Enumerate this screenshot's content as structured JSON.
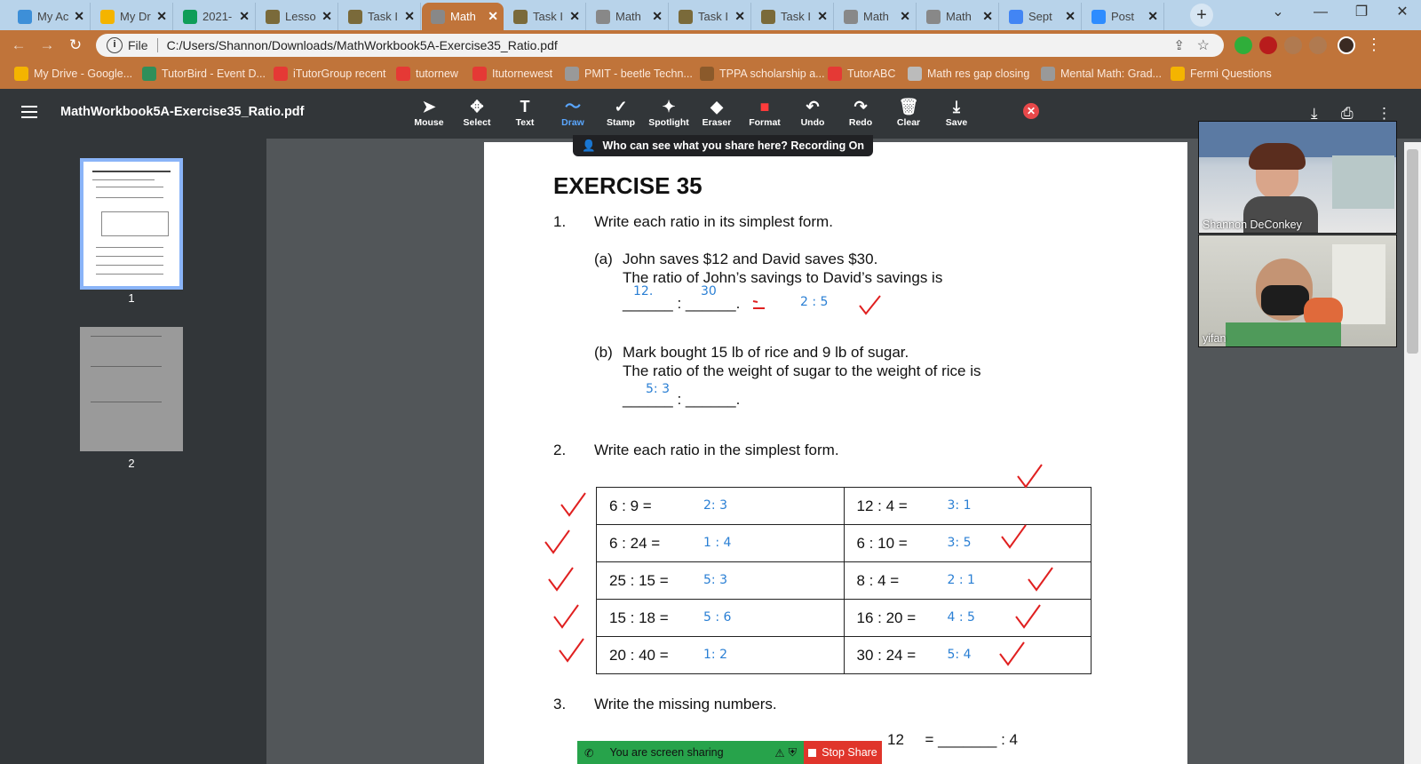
{
  "tabs": [
    {
      "label": "My Ac",
      "color": "#3d8fd8"
    },
    {
      "label": "My Dr",
      "color": "#f4b400"
    },
    {
      "label": "2021-",
      "color": "#0f9d58"
    },
    {
      "label": "Lesso",
      "color": "#7a6a3a"
    },
    {
      "label": "Task I",
      "color": "#7a6a3a"
    },
    {
      "label": "Math",
      "color": "#888888"
    },
    {
      "label": "Task I",
      "color": "#7a6a3a"
    },
    {
      "label": "Math",
      "color": "#888888"
    },
    {
      "label": "Task I",
      "color": "#7a6a3a"
    },
    {
      "label": "Task I",
      "color": "#7a6a3a"
    },
    {
      "label": "Math",
      "color": "#888888"
    },
    {
      "label": "Math",
      "color": "#888888"
    },
    {
      "label": "Sept",
      "color": "#4285f4"
    },
    {
      "label": "Post",
      "color": "#2d8cff"
    }
  ],
  "address": {
    "scheme_label": "File",
    "url": "C:/Users/Shannon/Downloads/MathWorkbook5A-Exercise35_Ratio.pdf"
  },
  "bookmarks": [
    {
      "label": "My Drive - Google...",
      "color": "#f4b400"
    },
    {
      "label": "TutorBird - Event D...",
      "color": "#2f8f5a"
    },
    {
      "label": "iTutorGroup recent",
      "color": "#e53935"
    },
    {
      "label": "tutornew",
      "color": "#e53935"
    },
    {
      "label": "Itutornewest",
      "color": "#e53935"
    },
    {
      "label": "PMIT - beetle Techn...",
      "color": "#999999"
    },
    {
      "label": "TPPA scholarship a...",
      "color": "#8b5a2b"
    },
    {
      "label": "TutorABC",
      "color": "#e53935"
    },
    {
      "label": "Math res gap closing",
      "color": "#bbbbbb"
    },
    {
      "label": "Mental Math: Grad...",
      "color": "#999999"
    },
    {
      "label": "Fermi Questions",
      "color": "#f4b400"
    }
  ],
  "viewer": {
    "filename": "MathWorkbook5A-Exercise35_Ratio.pdf"
  },
  "tools": [
    {
      "label": "Mouse",
      "icon": "cursor-icon",
      "glyph": "➤"
    },
    {
      "label": "Select",
      "icon": "move-icon",
      "glyph": "✥"
    },
    {
      "label": "Text",
      "icon": "text-icon",
      "glyph": "T"
    },
    {
      "label": "Draw",
      "icon": "draw-icon",
      "glyph": "〜"
    },
    {
      "label": "Stamp",
      "icon": "stamp-icon",
      "glyph": "✓"
    },
    {
      "label": "Spotlight",
      "icon": "spotlight-icon",
      "glyph": "✦"
    },
    {
      "label": "Eraser",
      "icon": "eraser-icon",
      "glyph": "◆"
    },
    {
      "label": "Format",
      "icon": "format-icon",
      "glyph": "■"
    },
    {
      "label": "Undo",
      "icon": "undo-icon",
      "glyph": "↶"
    },
    {
      "label": "Redo",
      "icon": "redo-icon",
      "glyph": "↷"
    },
    {
      "label": "Clear",
      "icon": "trash-icon",
      "glyph": "🗑"
    },
    {
      "label": "Save",
      "icon": "save-icon",
      "glyph": "⤓"
    }
  ],
  "share_notice": "Who can see what you share here? Recording On",
  "thumbnails": [
    "1",
    "2"
  ],
  "doc": {
    "title": "EXERCISE 35",
    "q1_num": "1.",
    "q1_text": "Write each ratio in its simplest form.",
    "q1a_label": "(a)",
    "q1a_line1": "John saves $12 and David saves $30.",
    "q1a_line2": "The ratio of John’s savings to David’s savings is",
    "q1a_blank": "______ : ______.",
    "q1a_hw1": "12.",
    "q1a_hw2": "30",
    "q1a_hw3": "2 : 5",
    "q1b_label": "(b)",
    "q1b_line1": "Mark bought 15 lb of rice and 9 lb of sugar.",
    "q1b_line2": "The ratio of the weight of sugar to the weight of rice is",
    "q1b_blank": "______ : ______.",
    "q1b_hw": "5: 3",
    "q2_num": "2.",
    "q2_text": "Write each ratio in the simplest form.",
    "q3_num": "3.",
    "q3_text": "Write the missing numbers.",
    "q3_partial": "12     = _______ : 4",
    "rows": [
      {
        "left": "6 : 9   =",
        "left_ans": "2: 3",
        "right": "12 : 4   =",
        "right_ans": "3: 1"
      },
      {
        "left": "6 : 24 =",
        "left_ans": "1 : 4",
        "right": "6 : 10 =",
        "right_ans": "3: 5"
      },
      {
        "left": "25 : 15 =",
        "left_ans": "5: 3",
        "right": "8 : 4   =",
        "right_ans": "2 : 1"
      },
      {
        "left": "15 : 18 =",
        "left_ans": "5 : 6",
        "right": "16 : 20 =",
        "right_ans": "4 : 5"
      },
      {
        "left": "20 : 40 =",
        "left_ans": "1: 2",
        "right": "30 : 24 =",
        "right_ans": "5: 4"
      }
    ]
  },
  "participants": [
    "Shannon DeConkey",
    "yifan"
  ],
  "sharing": {
    "status": "You are screen sharing",
    "stop": "Stop Share"
  }
}
